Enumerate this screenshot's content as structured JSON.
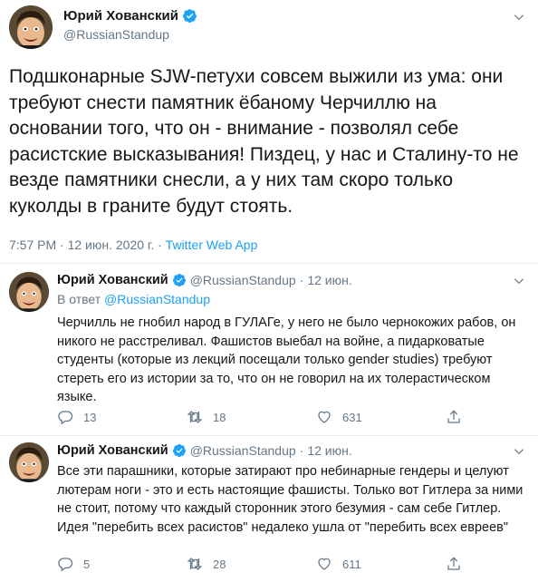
{
  "main_tweet": {
    "display_name": "Юрий Хованский",
    "handle": "@RussianStandup",
    "text": "Подшконарные SJW-петухи совсем выжили из ума: они требуют снести памятник ёбаному Черчиллю на основании того, что он - внимание - позволял себе расистские высказывания! Пиздец, у нас и Сталину-то не везде памятники снесли, а у них там скоро только куколды в граните будут стоять.",
    "time": "7:57 PM",
    "date": "12 июн. 2020 г.",
    "separator": "·",
    "source": "Twitter Web App"
  },
  "replies": [
    {
      "display_name": "Юрий Хованский",
      "handle": "@RussianStandup",
      "separator": "·",
      "date": "12 июн.",
      "reply_prefix": "В ответ",
      "reply_mention": "@RussianStandup",
      "text": "Черчилль не гнобил народ в ГУЛАГе, у него не было чернокожих рабов, он никого не расстреливал. Фашистов выебал на войне, а пидарковатые студенты (которые из лекций посещали только gender studies) требуют стереть его из истории за то, что он не говорил на их толерастическом языке.",
      "counts": {
        "replies": "13",
        "retweets": "18",
        "likes": "631"
      }
    },
    {
      "display_name": "Юрий Хованский",
      "handle": "@RussianStandup",
      "separator": "·",
      "date": "12 июн.",
      "text": "Все эти парашники, которые затирают про небинарные гендеры и целуют лютерам ноги - это и есть настоящие фашисты. Только вот Гитлера за ними не стоит, потому что каждый сторонник этого безумия - сам себе Гитлер. Идея \"перебить всех расистов\" недалеко ушла от \"перебить всех евреев\"",
      "counts": {
        "replies": "5",
        "retweets": "28",
        "likes": "611"
      }
    }
  ],
  "colors": {
    "link": "#1da1f2",
    "secondary_text": "#657786",
    "primary_text": "#14171a",
    "divider": "#e6ecf0",
    "verified_badge": "#1da1f2"
  },
  "icons": {
    "verified": "verified-badge-icon",
    "more": "chevron-down-icon",
    "reply": "reply-icon",
    "retweet": "retweet-icon",
    "like": "heart-icon",
    "share": "share-icon"
  }
}
